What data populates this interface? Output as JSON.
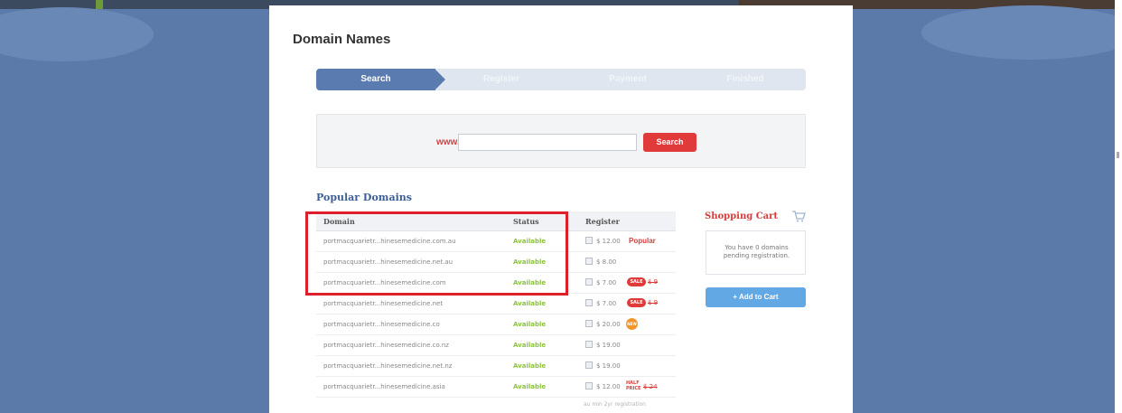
{
  "page": {
    "title": "Domain Names"
  },
  "steps": [
    "Search",
    "Register",
    "Payment",
    "Finished"
  ],
  "search": {
    "prefix": "www.",
    "value": "",
    "button_label": "Search"
  },
  "popular": {
    "title": "Popular Domains",
    "columns": {
      "domain": "Domain",
      "status": "Status",
      "register": "Register"
    },
    "rows": [
      {
        "domain": "portmacquarietr...hinesemedicine.com.au",
        "status": "Available",
        "price": "$ 12.00",
        "extra": "Popular"
      },
      {
        "domain": "portmacquarietr...hinesemedicine.net.au",
        "status": "Available",
        "price": "$ 8.00",
        "extra": ""
      },
      {
        "domain": "portmacquarietr...hinesemedicine.com",
        "status": "Available",
        "price": "$ 7.00",
        "tag": "SALE",
        "old_price": "$ 9"
      },
      {
        "domain": "portmacquarietr...hinesemedicine.net",
        "status": "Available",
        "price": "$ 7.00",
        "tag": "SALE",
        "old_price": "$ 9"
      },
      {
        "domain": "portmacquarietr...hinesemedicine.co",
        "status": "Available",
        "price": "$ 20.00",
        "badge": "NEW"
      },
      {
        "domain": "portmacquarietr...hinesemedicine.co.nz",
        "status": "Available",
        "price": "$ 19.00",
        "extra": ""
      },
      {
        "domain": "portmacquarietr...hinesemedicine.net.nz",
        "status": "Available",
        "price": "$ 19.00",
        "extra": ""
      },
      {
        "domain": "portmacquarietr...hinesemedicine.asia",
        "status": "Available",
        "price": "$ 12.00",
        "half": "HALF PRICE",
        "old_price": "$ 24"
      }
    ],
    "footnote": "au min 2yr registration"
  },
  "cart": {
    "title": "Shopping Cart",
    "message": "You have 0 domains pending registration.",
    "add_button": "+ Add to Cart"
  },
  "colors": {
    "background": "#5b7aaa",
    "accent_red": "#e03a3a",
    "step_active": "#5a7bb0",
    "available_green": "#8cc13f",
    "cart_button": "#62a8e4"
  }
}
